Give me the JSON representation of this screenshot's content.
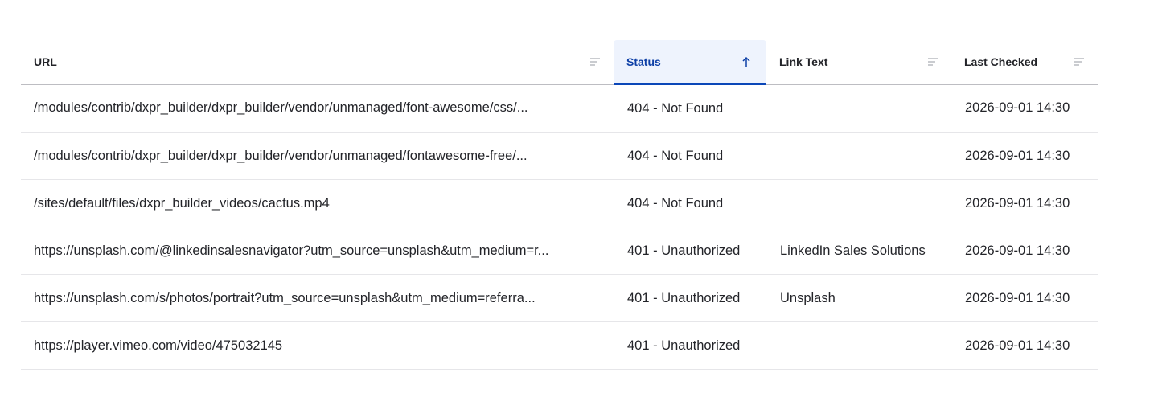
{
  "table": {
    "columns": [
      {
        "key": "url",
        "label": "URL",
        "sort_icon": "filter-lines-icon"
      },
      {
        "key": "status",
        "label": "Status",
        "sort_icon": "arrow-up-icon",
        "sorted": true
      },
      {
        "key": "link_text",
        "label": "Link Text",
        "sort_icon": "filter-lines-icon"
      },
      {
        "key": "last_checked",
        "label": "Last Checked",
        "sort_icon": "filter-lines-icon"
      }
    ],
    "rows": [
      {
        "url": "/modules/contrib/dxpr_builder/dxpr_builder/vendor/unmanaged/font-awesome/css/...",
        "status": "404 - Not Found",
        "link_text": "",
        "last_checked": "2026-09-01 14:30"
      },
      {
        "url": "/modules/contrib/dxpr_builder/dxpr_builder/vendor/unmanaged/fontawesome-free/...",
        "status": "404 - Not Found",
        "link_text": "",
        "last_checked": "2026-09-01 14:30"
      },
      {
        "url": "/sites/default/files/dxpr_builder_videos/cactus.mp4",
        "status": "404 - Not Found",
        "link_text": "",
        "last_checked": "2026-09-01 14:30"
      },
      {
        "url": "https://unsplash.com/@linkedinsalesnavigator?utm_source=unsplash&utm_medium=r...",
        "status": "401 - Unauthorized",
        "link_text": "LinkedIn Sales Solutions",
        "last_checked": "2026-09-01 14:30"
      },
      {
        "url": "https://unsplash.com/s/photos/portrait?utm_source=unsplash&utm_medium=referra...",
        "status": "401 - Unauthorized",
        "link_text": "Unsplash",
        "last_checked": "2026-09-01 14:30"
      },
      {
        "url": "https://player.vimeo.com/video/475032145",
        "status": "401 - Unauthorized",
        "link_text": "",
        "last_checked": "2026-09-01 14:30"
      }
    ]
  },
  "colors": {
    "sorted_header_bg": "#eef3fd",
    "sorted_header_text": "#0d3fa6",
    "sorted_header_underline": "#0b47b8",
    "header_divider": "#bdbdc2",
    "row_divider": "#e6e6e9",
    "icon_gray": "#b4b5bb"
  }
}
